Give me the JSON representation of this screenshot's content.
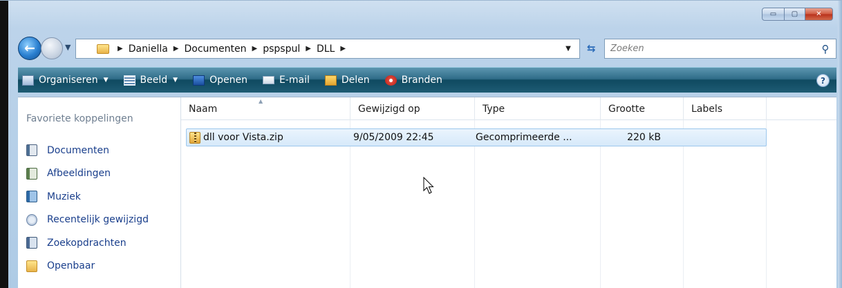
{
  "window": {
    "caption_buttons": {
      "minimize": "▭",
      "maximize": "▢",
      "close": "✕"
    }
  },
  "navigation": {
    "breadcrumb": [
      "Daniella",
      "Documenten",
      "pspspul",
      "DLL"
    ],
    "search_placeholder": "Zoeken"
  },
  "toolbar": {
    "items": [
      {
        "label": "Organiseren",
        "icon": "organize-icon",
        "has_dropdown": true
      },
      {
        "label": "Beeld",
        "icon": "views-icon",
        "has_dropdown": true
      },
      {
        "label": "Openen",
        "icon": "open-icon",
        "has_dropdown": false
      },
      {
        "label": "E-mail",
        "icon": "email-icon",
        "has_dropdown": false
      },
      {
        "label": "Delen",
        "icon": "share-icon",
        "has_dropdown": false
      },
      {
        "label": "Branden",
        "icon": "burn-icon",
        "has_dropdown": false
      }
    ],
    "help_label": "?"
  },
  "sidebar": {
    "title": "Favoriete koppelingen",
    "items": [
      {
        "label": "Documenten",
        "icon": "documents-icon"
      },
      {
        "label": "Afbeeldingen",
        "icon": "pictures-icon"
      },
      {
        "label": "Muziek",
        "icon": "music-icon"
      },
      {
        "label": "Recentelijk gewijzigd",
        "icon": "recent-icon"
      },
      {
        "label": "Zoekopdrachten",
        "icon": "searches-icon"
      },
      {
        "label": "Openbaar",
        "icon": "public-folder-icon"
      }
    ]
  },
  "file_list": {
    "columns": [
      "Naam",
      "Gewijzigd op",
      "Type",
      "Grootte",
      "Labels"
    ],
    "rows": [
      {
        "name": "dll voor Vista.zip",
        "modified": "9/05/2009 22:45",
        "type": "Gecomprimeerde ...",
        "size": "220 kB",
        "labels": "",
        "selected": true
      }
    ]
  },
  "colors": {
    "toolbar_bg": "#1e5c74",
    "link_text": "#1a3f8c",
    "selection_bg": "#d6e9fa",
    "selection_border": "#9cc7ec"
  }
}
